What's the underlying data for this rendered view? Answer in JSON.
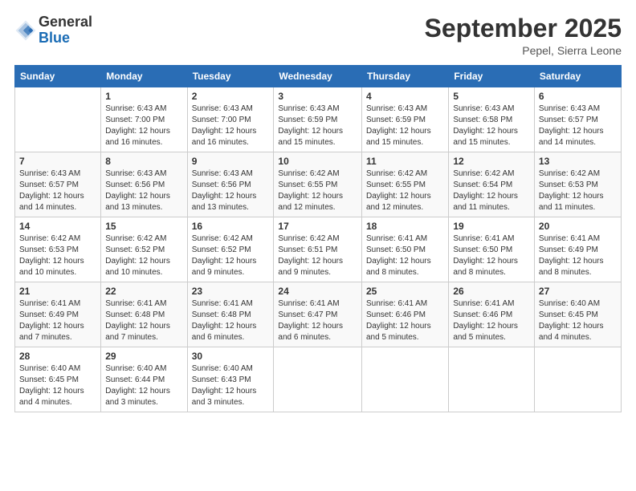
{
  "logo": {
    "general": "General",
    "blue": "Blue"
  },
  "title": "September 2025",
  "location": "Pepel, Sierra Leone",
  "days_of_week": [
    "Sunday",
    "Monday",
    "Tuesday",
    "Wednesday",
    "Thursday",
    "Friday",
    "Saturday"
  ],
  "weeks": [
    [
      {
        "day": "",
        "sunrise": "",
        "sunset": "",
        "daylight": ""
      },
      {
        "day": "1",
        "sunrise": "Sunrise: 6:43 AM",
        "sunset": "Sunset: 7:00 PM",
        "daylight": "Daylight: 12 hours and 16 minutes."
      },
      {
        "day": "2",
        "sunrise": "Sunrise: 6:43 AM",
        "sunset": "Sunset: 7:00 PM",
        "daylight": "Daylight: 12 hours and 16 minutes."
      },
      {
        "day": "3",
        "sunrise": "Sunrise: 6:43 AM",
        "sunset": "Sunset: 6:59 PM",
        "daylight": "Daylight: 12 hours and 15 minutes."
      },
      {
        "day": "4",
        "sunrise": "Sunrise: 6:43 AM",
        "sunset": "Sunset: 6:59 PM",
        "daylight": "Daylight: 12 hours and 15 minutes."
      },
      {
        "day": "5",
        "sunrise": "Sunrise: 6:43 AM",
        "sunset": "Sunset: 6:58 PM",
        "daylight": "Daylight: 12 hours and 15 minutes."
      },
      {
        "day": "6",
        "sunrise": "Sunrise: 6:43 AM",
        "sunset": "Sunset: 6:57 PM",
        "daylight": "Daylight: 12 hours and 14 minutes."
      }
    ],
    [
      {
        "day": "7",
        "sunrise": "Sunrise: 6:43 AM",
        "sunset": "Sunset: 6:57 PM",
        "daylight": "Daylight: 12 hours and 14 minutes."
      },
      {
        "day": "8",
        "sunrise": "Sunrise: 6:43 AM",
        "sunset": "Sunset: 6:56 PM",
        "daylight": "Daylight: 12 hours and 13 minutes."
      },
      {
        "day": "9",
        "sunrise": "Sunrise: 6:43 AM",
        "sunset": "Sunset: 6:56 PM",
        "daylight": "Daylight: 12 hours and 13 minutes."
      },
      {
        "day": "10",
        "sunrise": "Sunrise: 6:42 AM",
        "sunset": "Sunset: 6:55 PM",
        "daylight": "Daylight: 12 hours and 12 minutes."
      },
      {
        "day": "11",
        "sunrise": "Sunrise: 6:42 AM",
        "sunset": "Sunset: 6:55 PM",
        "daylight": "Daylight: 12 hours and 12 minutes."
      },
      {
        "day": "12",
        "sunrise": "Sunrise: 6:42 AM",
        "sunset": "Sunset: 6:54 PM",
        "daylight": "Daylight: 12 hours and 11 minutes."
      },
      {
        "day": "13",
        "sunrise": "Sunrise: 6:42 AM",
        "sunset": "Sunset: 6:53 PM",
        "daylight": "Daylight: 12 hours and 11 minutes."
      }
    ],
    [
      {
        "day": "14",
        "sunrise": "Sunrise: 6:42 AM",
        "sunset": "Sunset: 6:53 PM",
        "daylight": "Daylight: 12 hours and 10 minutes."
      },
      {
        "day": "15",
        "sunrise": "Sunrise: 6:42 AM",
        "sunset": "Sunset: 6:52 PM",
        "daylight": "Daylight: 12 hours and 10 minutes."
      },
      {
        "day": "16",
        "sunrise": "Sunrise: 6:42 AM",
        "sunset": "Sunset: 6:52 PM",
        "daylight": "Daylight: 12 hours and 9 minutes."
      },
      {
        "day": "17",
        "sunrise": "Sunrise: 6:42 AM",
        "sunset": "Sunset: 6:51 PM",
        "daylight": "Daylight: 12 hours and 9 minutes."
      },
      {
        "day": "18",
        "sunrise": "Sunrise: 6:41 AM",
        "sunset": "Sunset: 6:50 PM",
        "daylight": "Daylight: 12 hours and 8 minutes."
      },
      {
        "day": "19",
        "sunrise": "Sunrise: 6:41 AM",
        "sunset": "Sunset: 6:50 PM",
        "daylight": "Daylight: 12 hours and 8 minutes."
      },
      {
        "day": "20",
        "sunrise": "Sunrise: 6:41 AM",
        "sunset": "Sunset: 6:49 PM",
        "daylight": "Daylight: 12 hours and 8 minutes."
      }
    ],
    [
      {
        "day": "21",
        "sunrise": "Sunrise: 6:41 AM",
        "sunset": "Sunset: 6:49 PM",
        "daylight": "Daylight: 12 hours and 7 minutes."
      },
      {
        "day": "22",
        "sunrise": "Sunrise: 6:41 AM",
        "sunset": "Sunset: 6:48 PM",
        "daylight": "Daylight: 12 hours and 7 minutes."
      },
      {
        "day": "23",
        "sunrise": "Sunrise: 6:41 AM",
        "sunset": "Sunset: 6:48 PM",
        "daylight": "Daylight: 12 hours and 6 minutes."
      },
      {
        "day": "24",
        "sunrise": "Sunrise: 6:41 AM",
        "sunset": "Sunset: 6:47 PM",
        "daylight": "Daylight: 12 hours and 6 minutes."
      },
      {
        "day": "25",
        "sunrise": "Sunrise: 6:41 AM",
        "sunset": "Sunset: 6:46 PM",
        "daylight": "Daylight: 12 hours and 5 minutes."
      },
      {
        "day": "26",
        "sunrise": "Sunrise: 6:41 AM",
        "sunset": "Sunset: 6:46 PM",
        "daylight": "Daylight: 12 hours and 5 minutes."
      },
      {
        "day": "27",
        "sunrise": "Sunrise: 6:40 AM",
        "sunset": "Sunset: 6:45 PM",
        "daylight": "Daylight: 12 hours and 4 minutes."
      }
    ],
    [
      {
        "day": "28",
        "sunrise": "Sunrise: 6:40 AM",
        "sunset": "Sunset: 6:45 PM",
        "daylight": "Daylight: 12 hours and 4 minutes."
      },
      {
        "day": "29",
        "sunrise": "Sunrise: 6:40 AM",
        "sunset": "Sunset: 6:44 PM",
        "daylight": "Daylight: 12 hours and 3 minutes."
      },
      {
        "day": "30",
        "sunrise": "Sunrise: 6:40 AM",
        "sunset": "Sunset: 6:43 PM",
        "daylight": "Daylight: 12 hours and 3 minutes."
      },
      {
        "day": "",
        "sunrise": "",
        "sunset": "",
        "daylight": ""
      },
      {
        "day": "",
        "sunrise": "",
        "sunset": "",
        "daylight": ""
      },
      {
        "day": "",
        "sunrise": "",
        "sunset": "",
        "daylight": ""
      },
      {
        "day": "",
        "sunrise": "",
        "sunset": "",
        "daylight": ""
      }
    ]
  ]
}
